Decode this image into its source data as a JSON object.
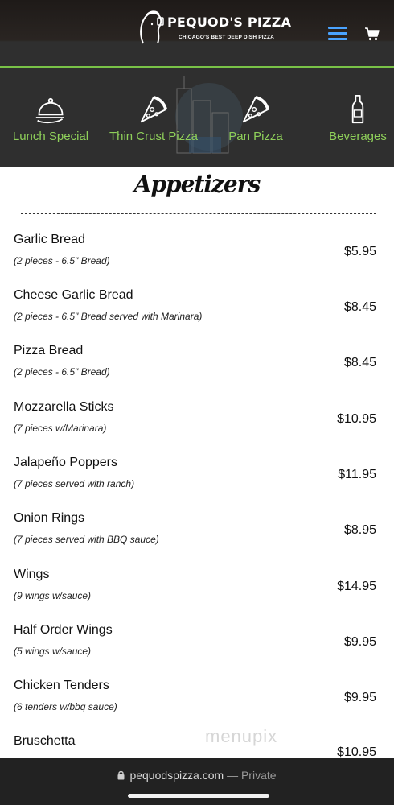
{
  "header": {
    "brand_name": "PEQUOD'S PIZZA",
    "tagline": "CHICAGO'S BEST DEEP DISH PIZZA",
    "menu_icon": "hamburger-menu-icon",
    "cart_icon": "shopping-cart-icon",
    "accent_color": "#79c247",
    "menu_icon_color": "#4aa3ff"
  },
  "categories": [
    {
      "label": "Lunch Special",
      "icon": "cloche-icon"
    },
    {
      "label": "Thin Crust Pizza",
      "icon": "pizza-slice-icon"
    },
    {
      "label": "Pan Pizza",
      "icon": "pizza-slice-icon"
    },
    {
      "label": "Beverages",
      "icon": "bottle-icon"
    }
  ],
  "section": {
    "title": "Appetizers"
  },
  "items": [
    {
      "name": "Garlic Bread",
      "desc": "(2 pieces - 6.5\" Bread)",
      "price": "$5.95"
    },
    {
      "name": "Cheese Garlic Bread",
      "desc": "(2 pieces - 6.5\" Bread served with Marinara)",
      "price": "$8.45"
    },
    {
      "name": "Pizza Bread",
      "desc": "(2 pieces - 6.5\" Bread)",
      "price": "$8.45"
    },
    {
      "name": "Mozzarella Sticks",
      "desc": "(7 pieces w/Marinara)",
      "price": "$10.95"
    },
    {
      "name": "Jalapeño Poppers",
      "desc": "(7 pieces served with ranch)",
      "price": "$11.95"
    },
    {
      "name": "Onion Rings",
      "desc": "(7 pieces served with BBQ sauce)",
      "price": "$8.95"
    },
    {
      "name": "Wings",
      "desc": "(9 wings w/sauce)",
      "price": "$14.95"
    },
    {
      "name": "Half Order Wings",
      "desc": "(5 wings w/sauce)",
      "price": "$9.95"
    },
    {
      "name": "Chicken Tenders",
      "desc": "(6 tenders w/bbq sauce)",
      "price": "$9.95"
    },
    {
      "name": "Bruschetta",
      "desc": "",
      "price": "$10.95"
    }
  ],
  "watermark": "menupix",
  "browser": {
    "url": "pequodspizza.com",
    "separator": "—",
    "mode": "Private"
  }
}
